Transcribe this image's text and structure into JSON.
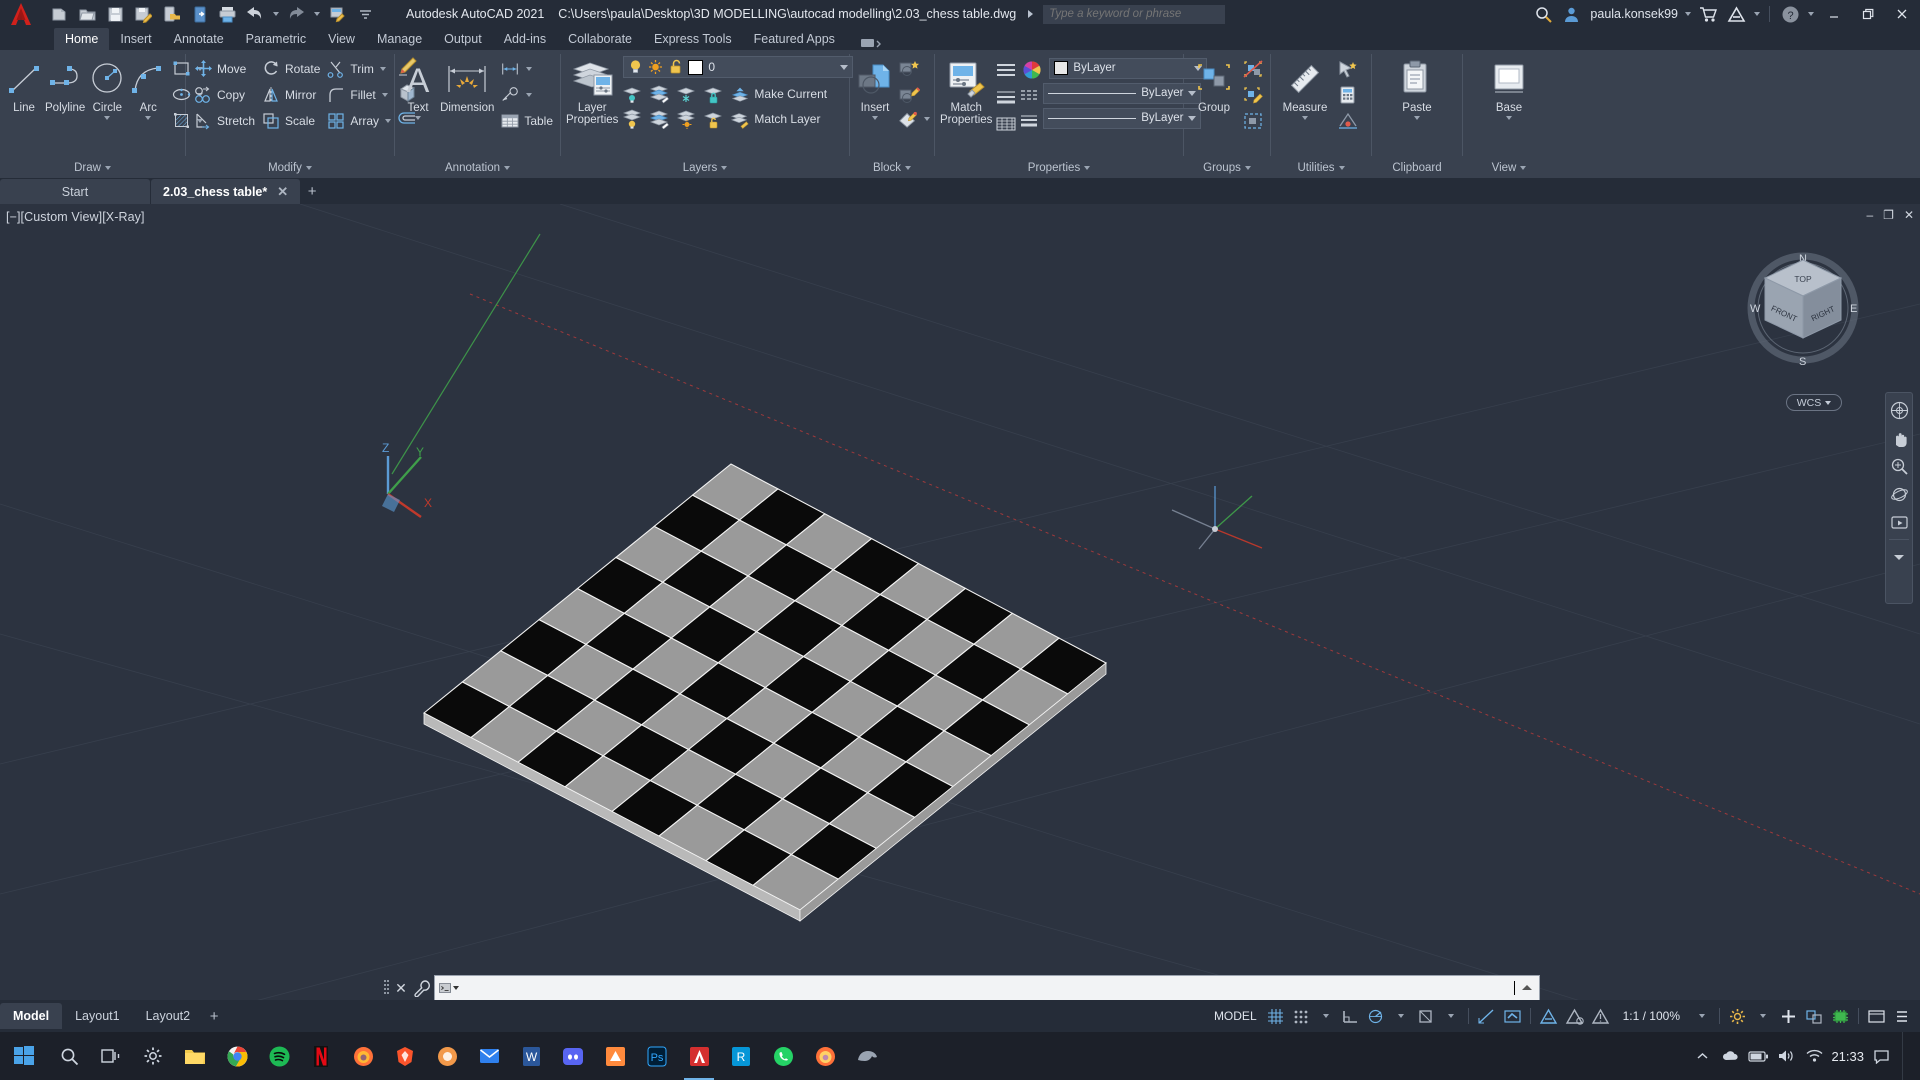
{
  "titlebar": {
    "app_title": "Autodesk AutoCAD 2021",
    "file_path": "C:\\Users\\paula\\Desktop\\3D MODELLING\\autocad modelling\\2.03_chess table.dwg",
    "search_placeholder": "Type a keyword or phrase",
    "user_name": "paula.konsek99",
    "qat": [
      {
        "name": "new-document",
        "tip": "New"
      },
      {
        "name": "open-document",
        "tip": "Open"
      },
      {
        "name": "save",
        "tip": "Save"
      },
      {
        "name": "save-as",
        "tip": "Save As"
      },
      {
        "name": "open-from-web",
        "tip": "Open from Web & Mobile"
      },
      {
        "name": "save-to-web",
        "tip": "Save to Web & Mobile"
      },
      {
        "name": "plot",
        "tip": "Plot"
      },
      {
        "name": "undo",
        "tip": "Undo"
      },
      {
        "name": "redo",
        "tip": "Redo"
      },
      {
        "name": "batch-plot",
        "tip": "Batch Plot"
      },
      {
        "name": "customize-qat",
        "tip": "Customize"
      }
    ],
    "window_controls": {
      "minimize": "–",
      "restore": "❐",
      "close": "✕"
    }
  },
  "ribbon_tabs": [
    {
      "label": "Home",
      "active": true
    },
    {
      "label": "Insert",
      "active": false
    },
    {
      "label": "Annotate",
      "active": false
    },
    {
      "label": "Parametric",
      "active": false
    },
    {
      "label": "View",
      "active": false
    },
    {
      "label": "Manage",
      "active": false
    },
    {
      "label": "Output",
      "active": false
    },
    {
      "label": "Add-ins",
      "active": false
    },
    {
      "label": "Collaborate",
      "active": false
    },
    {
      "label": "Express Tools",
      "active": false
    },
    {
      "label": "Featured Apps",
      "active": false
    }
  ],
  "ribbon": {
    "draw": {
      "title": "Draw",
      "big": [
        {
          "label": "Line",
          "icon": "line-icon",
          "dropdown": false
        },
        {
          "label": "Polyline",
          "icon": "polyline-icon",
          "dropdown": false
        },
        {
          "label": "Circle",
          "icon": "circle-icon",
          "dropdown": true
        },
        {
          "label": "Arc",
          "icon": "arc-icon",
          "dropdown": true
        }
      ],
      "small": [
        {
          "icon": "rectangle-icon",
          "dropdown": true
        },
        {
          "icon": "ellipse-icon",
          "dropdown": true
        },
        {
          "icon": "hatch-icon",
          "dropdown": true
        }
      ]
    },
    "modify": {
      "title": "Modify",
      "col1": [
        {
          "label": "Move",
          "icon": "move-icon"
        },
        {
          "label": "Copy",
          "icon": "copy-icon"
        },
        {
          "label": "Stretch",
          "icon": "stretch-icon"
        }
      ],
      "col2": [
        {
          "label": "Rotate",
          "icon": "rotate-icon"
        },
        {
          "label": "Mirror",
          "icon": "mirror-icon"
        },
        {
          "label": "Scale",
          "icon": "scale-icon"
        }
      ],
      "col3": [
        {
          "label": "Trim",
          "icon": "trim-icon",
          "dropdown": true
        },
        {
          "label": "Fillet",
          "icon": "fillet-icon",
          "dropdown": true
        },
        {
          "label": "Array",
          "icon": "array-icon",
          "dropdown": true
        }
      ],
      "col4": [
        {
          "icon": "erase-icon"
        },
        {
          "icon": "explode-icon"
        },
        {
          "icon": "offset-icon"
        }
      ]
    },
    "annotation": {
      "title": "Annotation",
      "big": [
        {
          "label": "Text",
          "icon": "text-icon",
          "dropdown": true
        },
        {
          "label": "Dimension",
          "icon": "dimension-icon",
          "dropdown": false
        }
      ],
      "small": [
        {
          "icon": "linear-dimension-icon",
          "dropdown": true
        },
        {
          "icon": "leader-icon",
          "dropdown": true
        },
        {
          "label": "Table",
          "icon": "table-icon",
          "dropdown": false
        }
      ]
    },
    "layers": {
      "title": "Layers",
      "big": {
        "label": "Layer\nProperties",
        "label1": "Layer",
        "label2": "Properties",
        "icon": "layer-properties-icon"
      },
      "layer_control": {
        "current_layer": "0",
        "color": "#ffffff",
        "on": true,
        "frozen": false,
        "locked": false
      },
      "row1": [
        {
          "icon": "layer-isolate-icon"
        },
        {
          "icon": "layer-unisolate-icon"
        },
        {
          "icon": "layer-freeze-icon"
        },
        {
          "icon": "layer-lock-icon"
        },
        {
          "label": "Make Current",
          "icon": "make-current-icon"
        }
      ],
      "row2": [
        {
          "icon": "layer-off-icon"
        },
        {
          "icon": "layer-turn-all-on-icon"
        },
        {
          "icon": "layer-thaw-all-icon"
        },
        {
          "icon": "layer-unlock-icon"
        },
        {
          "label": "Match Layer",
          "icon": "match-layer-icon"
        }
      ]
    },
    "block": {
      "title": "Block",
      "big": {
        "label": "Insert",
        "icon": "insert-block-icon",
        "dropdown": true
      },
      "small": [
        {
          "icon": "create-block-icon"
        },
        {
          "icon": "edit-block-icon"
        },
        {
          "icon": "edit-attribute-icon",
          "dropdown": true
        }
      ]
    },
    "properties": {
      "title": "Properties",
      "big": {
        "label1": "Match",
        "label2": "Properties",
        "icon": "match-properties-icon"
      },
      "color": {
        "value": "ByLayer",
        "icon": "color-wheel-icon"
      },
      "linetype": {
        "value": "ByLayer",
        "icon": "linetype-icon"
      },
      "lineweight": {
        "value": "ByLayer",
        "icon": "lineweight-icon"
      },
      "transparency_icon": "transparency-icon",
      "list_icon": "properties-list-icon"
    },
    "groups": {
      "title": "Groups",
      "big": {
        "label": "Group",
        "icon": "group-icon"
      },
      "small": [
        {
          "icon": "ungroup-icon"
        },
        {
          "icon": "group-edit-icon"
        }
      ]
    },
    "utilities": {
      "title": "Utilities",
      "big": {
        "label": "Measure",
        "icon": "measure-icon",
        "dropdown": true
      },
      "small": [
        {
          "icon": "quick-select-icon"
        },
        {
          "icon": "quick-calc-icon"
        },
        {
          "icon": "id-point-icon"
        }
      ]
    },
    "clipboard": {
      "title": "Clipboard",
      "big": {
        "label": "Paste",
        "icon": "paste-icon",
        "dropdown": true
      },
      "small": [
        {
          "icon": "copy-clip-icon"
        },
        {
          "icon": "cut-clip-icon"
        },
        {
          "icon": "paste-special-icon"
        }
      ]
    },
    "view": {
      "title": "View",
      "big": {
        "label": "Base",
        "icon": "base-view-icon",
        "dropdown": true
      }
    }
  },
  "file_tabs": [
    {
      "label": "Start",
      "active": false,
      "closable": false
    },
    {
      "label": "2.03_chess table*",
      "active": true,
      "closable": true,
      "close_glyph": "✕"
    }
  ],
  "file_tab_add": "+",
  "viewport": {
    "label": "[−][Custom View][X-Ray]",
    "wcs_badge": "WCS",
    "ucs_axes": {
      "x": "X",
      "y": "Y",
      "z": "Z"
    },
    "viewcube": {
      "top": "TOP",
      "front": "FRONT",
      "right": "RIGHT",
      "n": "N",
      "s": "S",
      "e": "E",
      "w": "W"
    },
    "window_controls": {
      "minimize": "–",
      "restore": "❐",
      "close": "✕"
    },
    "model": {
      "name": "chessboard",
      "squares": 8,
      "light_color": "#9a9a9a",
      "dark_color": "#0a0a0a",
      "edge_color": "#f2f2f2",
      "side_color": "#b9b9b9"
    }
  },
  "command_line": {
    "prompt": "",
    "value": "",
    "icon": "command-prompt-icon",
    "close_glyph": "✕",
    "wrench_icon": "customize-icon",
    "expand_glyph": "▴"
  },
  "layout_tabs": [
    {
      "label": "Model",
      "active": true
    },
    {
      "label": "Layout1",
      "active": false
    },
    {
      "label": "Layout2",
      "active": false
    }
  ],
  "layout_add": "+",
  "status_bar": {
    "space_label": "MODEL",
    "scale": "1:1 / 100%",
    "items": [
      {
        "name": "grid-display",
        "icon": "grid-icon",
        "on": true
      },
      {
        "name": "snap-mode",
        "icon": "snap-icon",
        "on": false,
        "dropdown": true
      },
      {
        "name": "ortho-mode",
        "icon": "ortho-icon",
        "on": false
      },
      {
        "name": "polar-tracking",
        "icon": "polar-icon",
        "on": true,
        "dropdown": true
      },
      {
        "name": "object-snap",
        "icon": "osnap-icon",
        "on": false,
        "dropdown": true
      },
      {
        "name": "object-snap-tracking",
        "icon": "otrack-icon",
        "on": true
      },
      {
        "name": "lineweight-display",
        "icon": "lwdisplay-icon",
        "on": true
      },
      {
        "name": "transparency-display",
        "icon": "transparency-display-icon",
        "on": true
      },
      {
        "name": "selection-cycling",
        "icon": "selection-cycling-icon",
        "on": true
      },
      {
        "name": "annotation-monitor",
        "icon": "annotation-monitor-icon",
        "on": false
      },
      {
        "name": "annotation-scale",
        "icon": "annotation-scale-icon",
        "on": false
      },
      {
        "name": "workspace-switching",
        "icon": "gear-icon",
        "on": false,
        "dropdown": true
      },
      {
        "name": "customization",
        "icon": "plus-icon",
        "on": false
      },
      {
        "name": "isolate-objects",
        "icon": "isolate-objects-icon",
        "on": false
      },
      {
        "name": "hardware-acceleration",
        "icon": "hardware-accel-icon",
        "on": true
      },
      {
        "name": "clean-screen",
        "icon": "clean-screen-icon",
        "on": false
      },
      {
        "name": "status-menu",
        "icon": "status-menu-icon",
        "on": false
      }
    ]
  },
  "taskbar": {
    "start_icon": "windows-start-icon",
    "items": [
      {
        "name": "search-icon",
        "color": "#cfd6e0"
      },
      {
        "name": "task-view-icon",
        "color": "#cfd6e0"
      },
      {
        "name": "settings-icon",
        "color": "#cfd6e0"
      },
      {
        "name": "file-explorer-icon",
        "color": "#f2c94c"
      },
      {
        "name": "chrome-icon",
        "color": "#4285f4"
      },
      {
        "name": "spotify-icon",
        "color": "#1db954"
      },
      {
        "name": "netflix-icon",
        "color": "#e50914"
      },
      {
        "name": "firefox-icon",
        "color": "#ff7139"
      },
      {
        "name": "brave-icon",
        "color": "#fb542b"
      },
      {
        "name": "app-orange-icon",
        "color": "#f2994a"
      },
      {
        "name": "mail-icon",
        "color": "#2f80ed"
      },
      {
        "name": "word-icon",
        "color": "#2b579a"
      },
      {
        "name": "discord-icon",
        "color": "#5865f2"
      },
      {
        "name": "autodesk-orange-icon",
        "color": "#ff8a3d"
      },
      {
        "name": "photoshop-icon",
        "color": "#001e36"
      },
      {
        "name": "autocad-icon",
        "color": "#e02c2c",
        "active": true
      },
      {
        "name": "revit-icon",
        "color": "#0696d7"
      },
      {
        "name": "whatsapp-icon",
        "color": "#25d366"
      },
      {
        "name": "firefox2-icon",
        "color": "#ff7139"
      },
      {
        "name": "rhino-icon",
        "color": "#7f8c9a"
      }
    ],
    "tray": [
      {
        "name": "show-hidden-icons",
        "glyph": "∧"
      },
      {
        "name": "onedrive-icon"
      },
      {
        "name": "battery-icon"
      },
      {
        "name": "volume-icon"
      },
      {
        "name": "wifi-icon"
      },
      {
        "name": "network-icon"
      }
    ],
    "time": "21:33",
    "action_center": "notifications-icon"
  }
}
